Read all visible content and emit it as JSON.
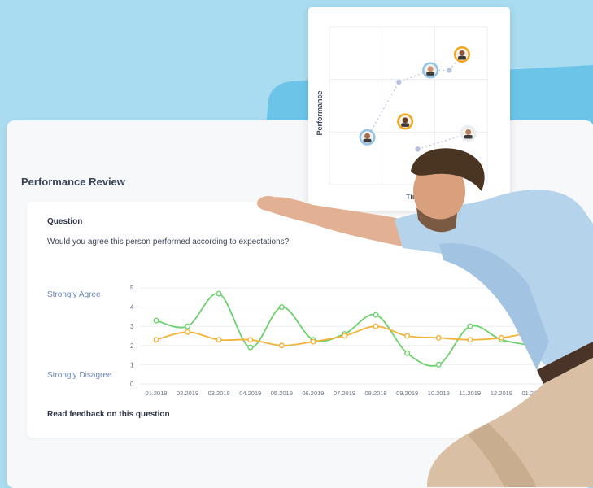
{
  "card": {
    "title": "Performance Review",
    "question_label": "Question",
    "question_text": "Would you agree this person performed according to expectations?",
    "feedback_link": "Read feedback on this question"
  },
  "scatter_popup": {
    "ylabel": "Performance",
    "xlabel": "Tim"
  },
  "colors": {
    "background": "#a9dcf0",
    "band": "#6cc5e8",
    "series_green": "#6bd16b",
    "series_orange": "#f2b33a",
    "axis_text": "#6b7286",
    "category_text": "#6b84b5"
  },
  "chart_data": [
    {
      "type": "line",
      "title": "",
      "x": [
        "01.2019",
        "02.2019",
        "03.2019",
        "04.2019",
        "05.2019",
        "06.2019",
        "07.2019",
        "08.2019",
        "09.2019",
        "10.2019",
        "11.2019",
        "12.2019",
        "01.2020"
      ],
      "ylim": [
        0,
        5
      ],
      "yticks": [
        0,
        1,
        2,
        3,
        4,
        5
      ],
      "category_labels": {
        "top": "Strongly Agree",
        "bottom": "Strongly Disagree"
      },
      "series": [
        {
          "name": "",
          "color": "#6bd16b",
          "values": [
            3.3,
            3.0,
            4.7,
            1.9,
            4.0,
            2.3,
            2.6,
            3.6,
            1.6,
            1.0,
            3.0,
            2.3,
            2.0
          ]
        },
        {
          "name": "",
          "color": "#f2b33a",
          "values": [
            2.3,
            2.7,
            2.3,
            2.3,
            2.0,
            2.2,
            2.5,
            3.0,
            2.5,
            2.4,
            2.3,
            2.4,
            2.7
          ]
        }
      ]
    },
    {
      "type": "scatter",
      "title": "",
      "xlabel": "Tim",
      "ylabel": "Performance",
      "grid": true,
      "avatars": [
        {
          "x": 1.2,
          "y": 1.2
        },
        {
          "x": 2.4,
          "y": 1.6
        },
        {
          "x": 3.2,
          "y": 2.9
        },
        {
          "x": 4.2,
          "y": 3.3
        },
        {
          "x": 4.4,
          "y": 1.3
        }
      ],
      "trail_points": [
        {
          "x": 2.2,
          "y": 2.6
        },
        {
          "x": 3.8,
          "y": 2.9
        },
        {
          "x": 2.8,
          "y": 0.9
        }
      ]
    }
  ]
}
